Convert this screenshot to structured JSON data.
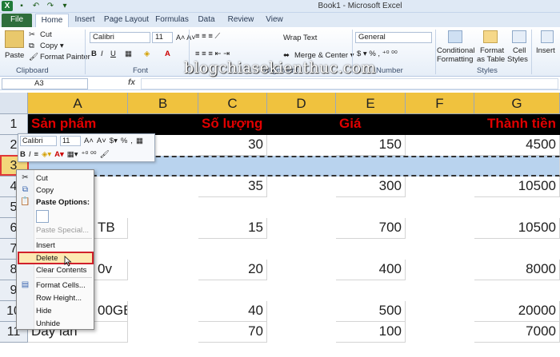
{
  "title_bar": {
    "title": "Book1  -  Microsoft Excel"
  },
  "tabs": [
    "File",
    "Home",
    "Insert",
    "Page Layout",
    "Formulas",
    "Data",
    "Review",
    "View"
  ],
  "ribbon": {
    "clipboard": {
      "paste": "Paste",
      "cut": "Cut",
      "copy": "Copy",
      "format_painter": "Format Painter",
      "label": "Clipboard"
    },
    "font": {
      "name": "Calibri",
      "size": "11",
      "label": "Font"
    },
    "alignment": {
      "wrap_text": "Wrap Text",
      "merge": "Merge & Center",
      "label": "Alignment"
    },
    "number": {
      "format": "General",
      "label": "Number"
    },
    "styles": {
      "conditional": "Conditional",
      "formatting": "Formatting",
      "format_as": "Format",
      "as_table": "as Table",
      "cell": "Cell",
      "styles_btn": "Styles",
      "label": "Styles"
    },
    "cells": {
      "insert": "Insert"
    },
    "watermark": "blogchiasekienthuc.com"
  },
  "formula_bar": {
    "name_box": "A3",
    "fx": "fx",
    "value": ""
  },
  "columns": [
    "A",
    "B",
    "C",
    "D",
    "E",
    "F",
    "G"
  ],
  "rows": [
    "1",
    "2",
    "3",
    "4",
    "5",
    "6",
    "7",
    "8",
    "9",
    "10",
    "11"
  ],
  "cells": {
    "A1": "Sản phẩm",
    "C1": "Số lượng",
    "E1": "Giá",
    "G1": "Thành tiền",
    "C2": "30",
    "E2": "150",
    "G2": "4500",
    "C4": "35",
    "E4": "300",
    "G4": "10500",
    "A6": "TB",
    "C6": "15",
    "E6": "700",
    "G6": "10500",
    "A8": "0v",
    "C8": "20",
    "E8": "400",
    "G8": "8000",
    "A10": "00GB",
    "C10": "40",
    "E10": "500",
    "G10": "20000",
    "A11": "Dây lan",
    "C11": "70",
    "E11": "100",
    "G11": "7000"
  },
  "mini_toolbar": {
    "font": "Calibri",
    "size": "11"
  },
  "context_menu": {
    "cut": "Cut",
    "copy": "Copy",
    "paste_options": "Paste Options:",
    "paste_special": "Paste Special...",
    "insert": "Insert",
    "delete": "Delete",
    "clear_contents": "Clear Contents",
    "format_cells": "Format Cells...",
    "row_height": "Row Height...",
    "hide": "Hide",
    "unhide": "Unhide"
  }
}
